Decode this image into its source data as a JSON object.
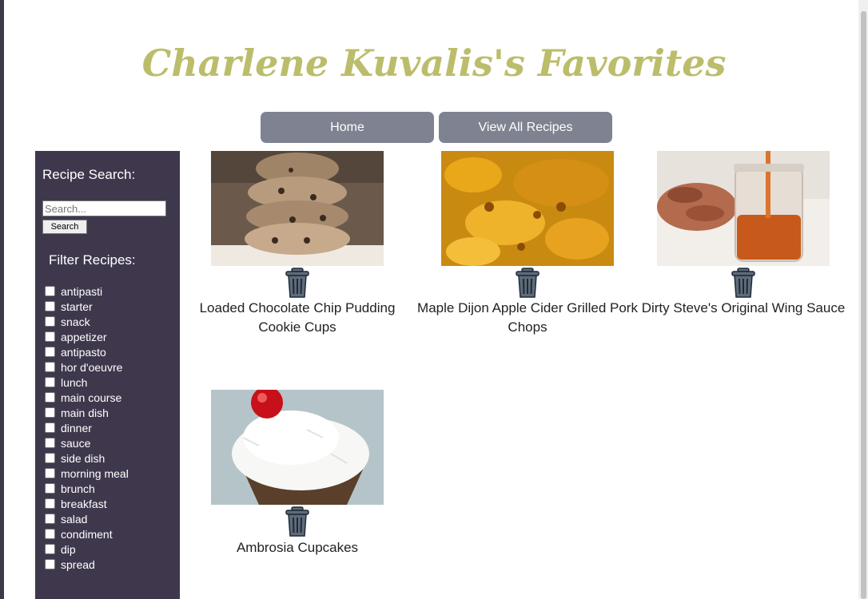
{
  "page_title": "Charlene Kuvalis's Favorites",
  "nav": {
    "home_label": "Home",
    "all_recipes_label": "View All Recipes"
  },
  "colors": {
    "title": "#bcbd6b",
    "nav_button": "#7f8391",
    "sidebar": "#3f384d"
  },
  "sidebar": {
    "search_heading": "Recipe Search:",
    "search_placeholder": "Search...",
    "search_button": "Search",
    "filter_heading": "Filter Recipes:",
    "filters": [
      "antipasti",
      "starter",
      "snack",
      "appetizer",
      "antipasto",
      "hor d'oeuvre",
      "lunch",
      "main course",
      "main dish",
      "dinner",
      "sauce",
      "side dish",
      "morning meal",
      "brunch",
      "breakfast",
      "salad",
      "condiment",
      "dip",
      "spread"
    ]
  },
  "recipes": [
    {
      "name": "Loaded Chocolate Chip Pudding Cookie Cups",
      "image": "cookie-stack-photo",
      "icon": "trash-icon"
    },
    {
      "name": "Maple Dijon Apple Cider Grilled Pork Chops",
      "image": "pork-chops-photo",
      "icon": "trash-icon"
    },
    {
      "name": "Dirty Steve's Original Wing Sauce",
      "image": "wing-sauce-photo",
      "icon": "trash-icon"
    },
    {
      "name": "Ambrosia Cupcakes",
      "image": "cupcake-photo",
      "icon": "trash-icon"
    }
  ]
}
